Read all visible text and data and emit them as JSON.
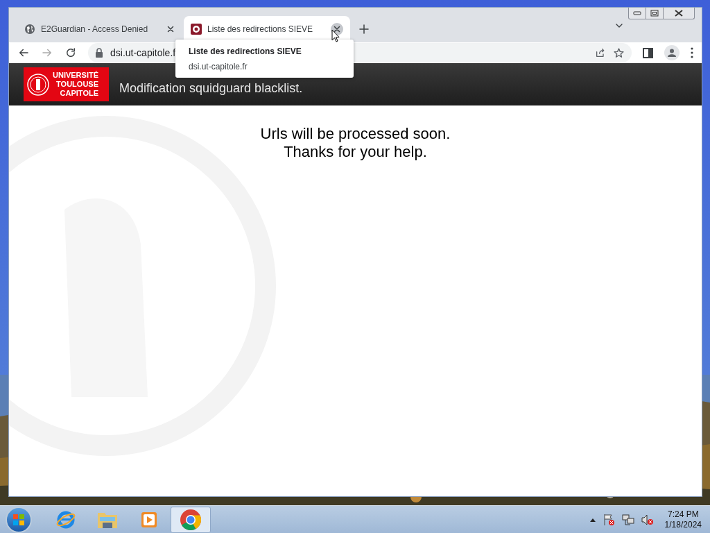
{
  "browser": {
    "tabs": [
      {
        "title": "E2Guardian - Access Denied",
        "selected": false,
        "kind": "globe"
      },
      {
        "title": "Liste des redirections SIEVE",
        "selected": true,
        "kind": "site"
      }
    ],
    "address": "dsi.ut-capitole.f",
    "tooltip": {
      "title": "Liste des redirections SIEVE",
      "url": "dsi.ut-capitole.fr"
    }
  },
  "page": {
    "logo": [
      "UNIVERSITÉ",
      "TOULOUSE",
      "CAPITOLE"
    ],
    "header": "Modification squidguard blacklist.",
    "message": [
      "Urls will be processed soon.",
      "Thanks for your help."
    ]
  },
  "taskbar": {
    "apps": [
      {
        "kind": "ie",
        "selected": false
      },
      {
        "kind": "folder",
        "selected": false
      },
      {
        "kind": "media",
        "selected": false
      },
      {
        "kind": "chrome",
        "selected": true
      }
    ],
    "time": "7:24 PM",
    "date": "1/18/2024"
  }
}
